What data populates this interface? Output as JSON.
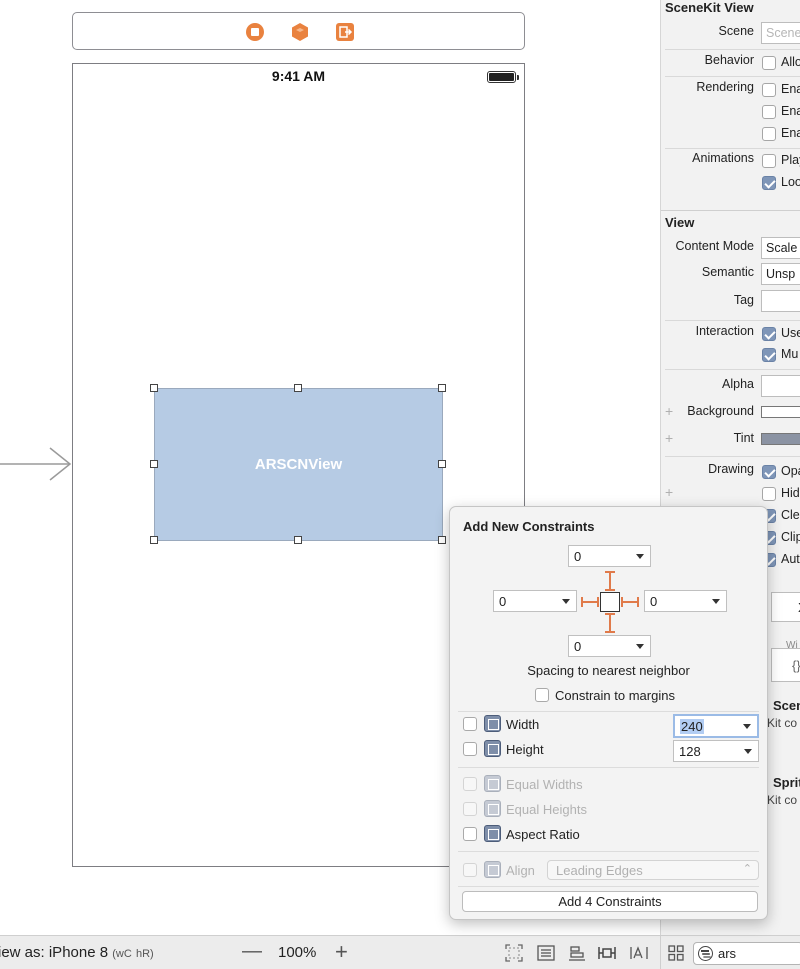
{
  "colors": {
    "accent": "#e07a4a",
    "view_fill": "#b6cbe4",
    "checkbox_on": "#7f96b8"
  },
  "scene_dock": {
    "icons": [
      "view-controller-icon",
      "first-responder-icon",
      "exit-icon"
    ]
  },
  "device": {
    "status_time": "9:41 AM"
  },
  "arscnview": {
    "label": "ARSCNView"
  },
  "bottom_bar": {
    "view_as_label": "iew as: iPhone 8",
    "size_class_w": "wC",
    "size_class_h": "hR",
    "zoom_minus": "—",
    "zoom_level": "100%",
    "zoom_plus": "+",
    "filter_value": "ars"
  },
  "inspector": {
    "sections": {
      "scenekit": "SceneKit View",
      "view": "View"
    },
    "scene_label": "Scene",
    "scene_placeholder": "Scene",
    "behavior_label": "Behavior",
    "behavior_check": "Allo",
    "rendering_label": "Rendering",
    "rendering_checks": [
      "Ena",
      "Ena",
      "Ena"
    ],
    "animations_label": "Animations",
    "animations_checks": [
      "Play",
      "Loo"
    ],
    "content_mode_label": "Content Mode",
    "content_mode_value": "Scale",
    "semantic_label": "Semantic",
    "semantic_value": "Unsp",
    "tag_label": "Tag",
    "interaction_label": "Interaction",
    "interaction_checks": [
      "Use",
      "Mu"
    ],
    "alpha_label": "Alpha",
    "background_label": "Background",
    "tint_label": "Tint",
    "drawing_label": "Drawing",
    "drawing_checks": [
      "Opa",
      "Hid",
      "Cle",
      "Clip",
      "Aut"
    ],
    "peek_x": "X",
    "peek_wi": "Wi",
    "peek_braces": "{}",
    "peek_scene_title": "Scen",
    "peek_scene_sub": "Kit co",
    "peek_sprite_title": "Sprit",
    "peek_sprite_sub": "Kit co"
  },
  "popover": {
    "title": "Add New Constraints",
    "top_value": "0",
    "left_value": "0",
    "right_value": "0",
    "bottom_value": "0",
    "spacing_caption": "Spacing to nearest neighbor",
    "constrain_margins": "Constrain to margins",
    "width_label": "Width",
    "width_value": "240",
    "height_label": "Height",
    "height_value": "128",
    "equal_widths": "Equal Widths",
    "equal_heights": "Equal Heights",
    "aspect_ratio": "Aspect Ratio",
    "align_label": "Align",
    "align_value": "Leading Edges",
    "add_button": "Add 4 Constraints"
  }
}
